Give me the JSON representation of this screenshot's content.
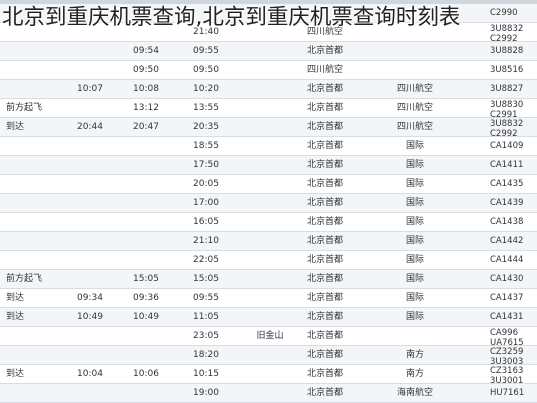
{
  "title": "北京到重庆机票查询,北京到重庆机票查询时刻表",
  "rows": [
    {
      "note": "",
      "t1": "",
      "t2": "",
      "t3": "",
      "b1": "",
      "apt": "",
      "air": "",
      "flt": "C2990"
    },
    {
      "note": "",
      "t1": "",
      "t2": "",
      "t3": "21:40",
      "b1": "",
      "apt": "四川航空",
      "air": "",
      "flt": "3U8832\nC2992"
    },
    {
      "note": "",
      "t1": "",
      "t2": "09:54",
      "t3": "09:55",
      "b1": "",
      "apt": "北京首都",
      "air": "",
      "flt": "3U8828"
    },
    {
      "note": "",
      "t1": "",
      "t2": "09:50",
      "t3": "09:50",
      "b1": "",
      "apt": "四川航空",
      "air": "",
      "flt": "3U8516"
    },
    {
      "note": "",
      "t1": "10:07",
      "t2": "10:08",
      "t3": "10:20",
      "b1": "",
      "apt": "北京首都",
      "air": "四川航空",
      "flt": "3U8827"
    },
    {
      "note": "前方起飞",
      "t1": "",
      "t2": "13:12",
      "t3": "13:55",
      "b1": "",
      "apt": "北京首都",
      "air": "四川航空",
      "flt": "3U8830\nC2991"
    },
    {
      "note": "到达",
      "t1": "20:44",
      "t2": "20:47",
      "t3": "20:35",
      "b1": "",
      "apt": "北京首都",
      "air": "四川航空",
      "flt": "3U8832\nC2992"
    },
    {
      "note": "",
      "t1": "",
      "t2": "",
      "t3": "18:55",
      "b1": "",
      "apt": "北京首都",
      "air": "国际",
      "flt": "CA1409"
    },
    {
      "note": "",
      "t1": "",
      "t2": "",
      "t3": "17:50",
      "b1": "",
      "apt": "北京首都",
      "air": "国际",
      "flt": "CA1411"
    },
    {
      "note": "",
      "t1": "",
      "t2": "",
      "t3": "20:05",
      "b1": "",
      "apt": "北京首都",
      "air": "国际",
      "flt": "CA1435"
    },
    {
      "note": "",
      "t1": "",
      "t2": "",
      "t3": "17:00",
      "b1": "",
      "apt": "北京首都",
      "air": "国际",
      "flt": "CA1439"
    },
    {
      "note": "",
      "t1": "",
      "t2": "",
      "t3": "16:05",
      "b1": "",
      "apt": "北京首都",
      "air": "国际",
      "flt": "CA1438"
    },
    {
      "note": "",
      "t1": "",
      "t2": "",
      "t3": "21:10",
      "b1": "",
      "apt": "北京首都",
      "air": "国际",
      "flt": "CA1442"
    },
    {
      "note": "",
      "t1": "",
      "t2": "",
      "t3": "22:05",
      "b1": "",
      "apt": "北京首都",
      "air": "国际",
      "flt": "CA1444"
    },
    {
      "note": "前方起飞",
      "t1": "",
      "t2": "15:05",
      "t3": "15:05",
      "b1": "",
      "apt": "北京首都",
      "air": "国际",
      "flt": "CA1430"
    },
    {
      "note": "到达",
      "t1": "09:34",
      "t2": "09:36",
      "t3": "09:55",
      "b1": "",
      "apt": "北京首都",
      "air": "国际",
      "flt": "CA1437"
    },
    {
      "note": "到达",
      "t1": "10:49",
      "t2": "10:49",
      "t3": "11:05",
      "b1": "",
      "apt": "北京首都",
      "air": "国际",
      "flt": "CA1431"
    },
    {
      "note": "",
      "t1": "",
      "t2": "",
      "t3": "23:05",
      "b1": "旧金山",
      "apt": "北京首都",
      "air": "",
      "flt": "CA996\nUA7615"
    },
    {
      "note": "",
      "t1": "",
      "t2": "",
      "t3": "18:20",
      "b1": "",
      "apt": "北京首都",
      "air": "南方",
      "flt": "CZ3259\n3U3003"
    },
    {
      "note": "到达",
      "t1": "10:04",
      "t2": "10:06",
      "t3": "10:15",
      "b1": "",
      "apt": "北京首都",
      "air": "南方",
      "flt": "CZ3163\n3U3001"
    },
    {
      "note": "",
      "t1": "",
      "t2": "",
      "t3": "19:00",
      "b1": "",
      "apt": "北京首都",
      "air": "海南航空",
      "flt": "HU7161"
    }
  ]
}
